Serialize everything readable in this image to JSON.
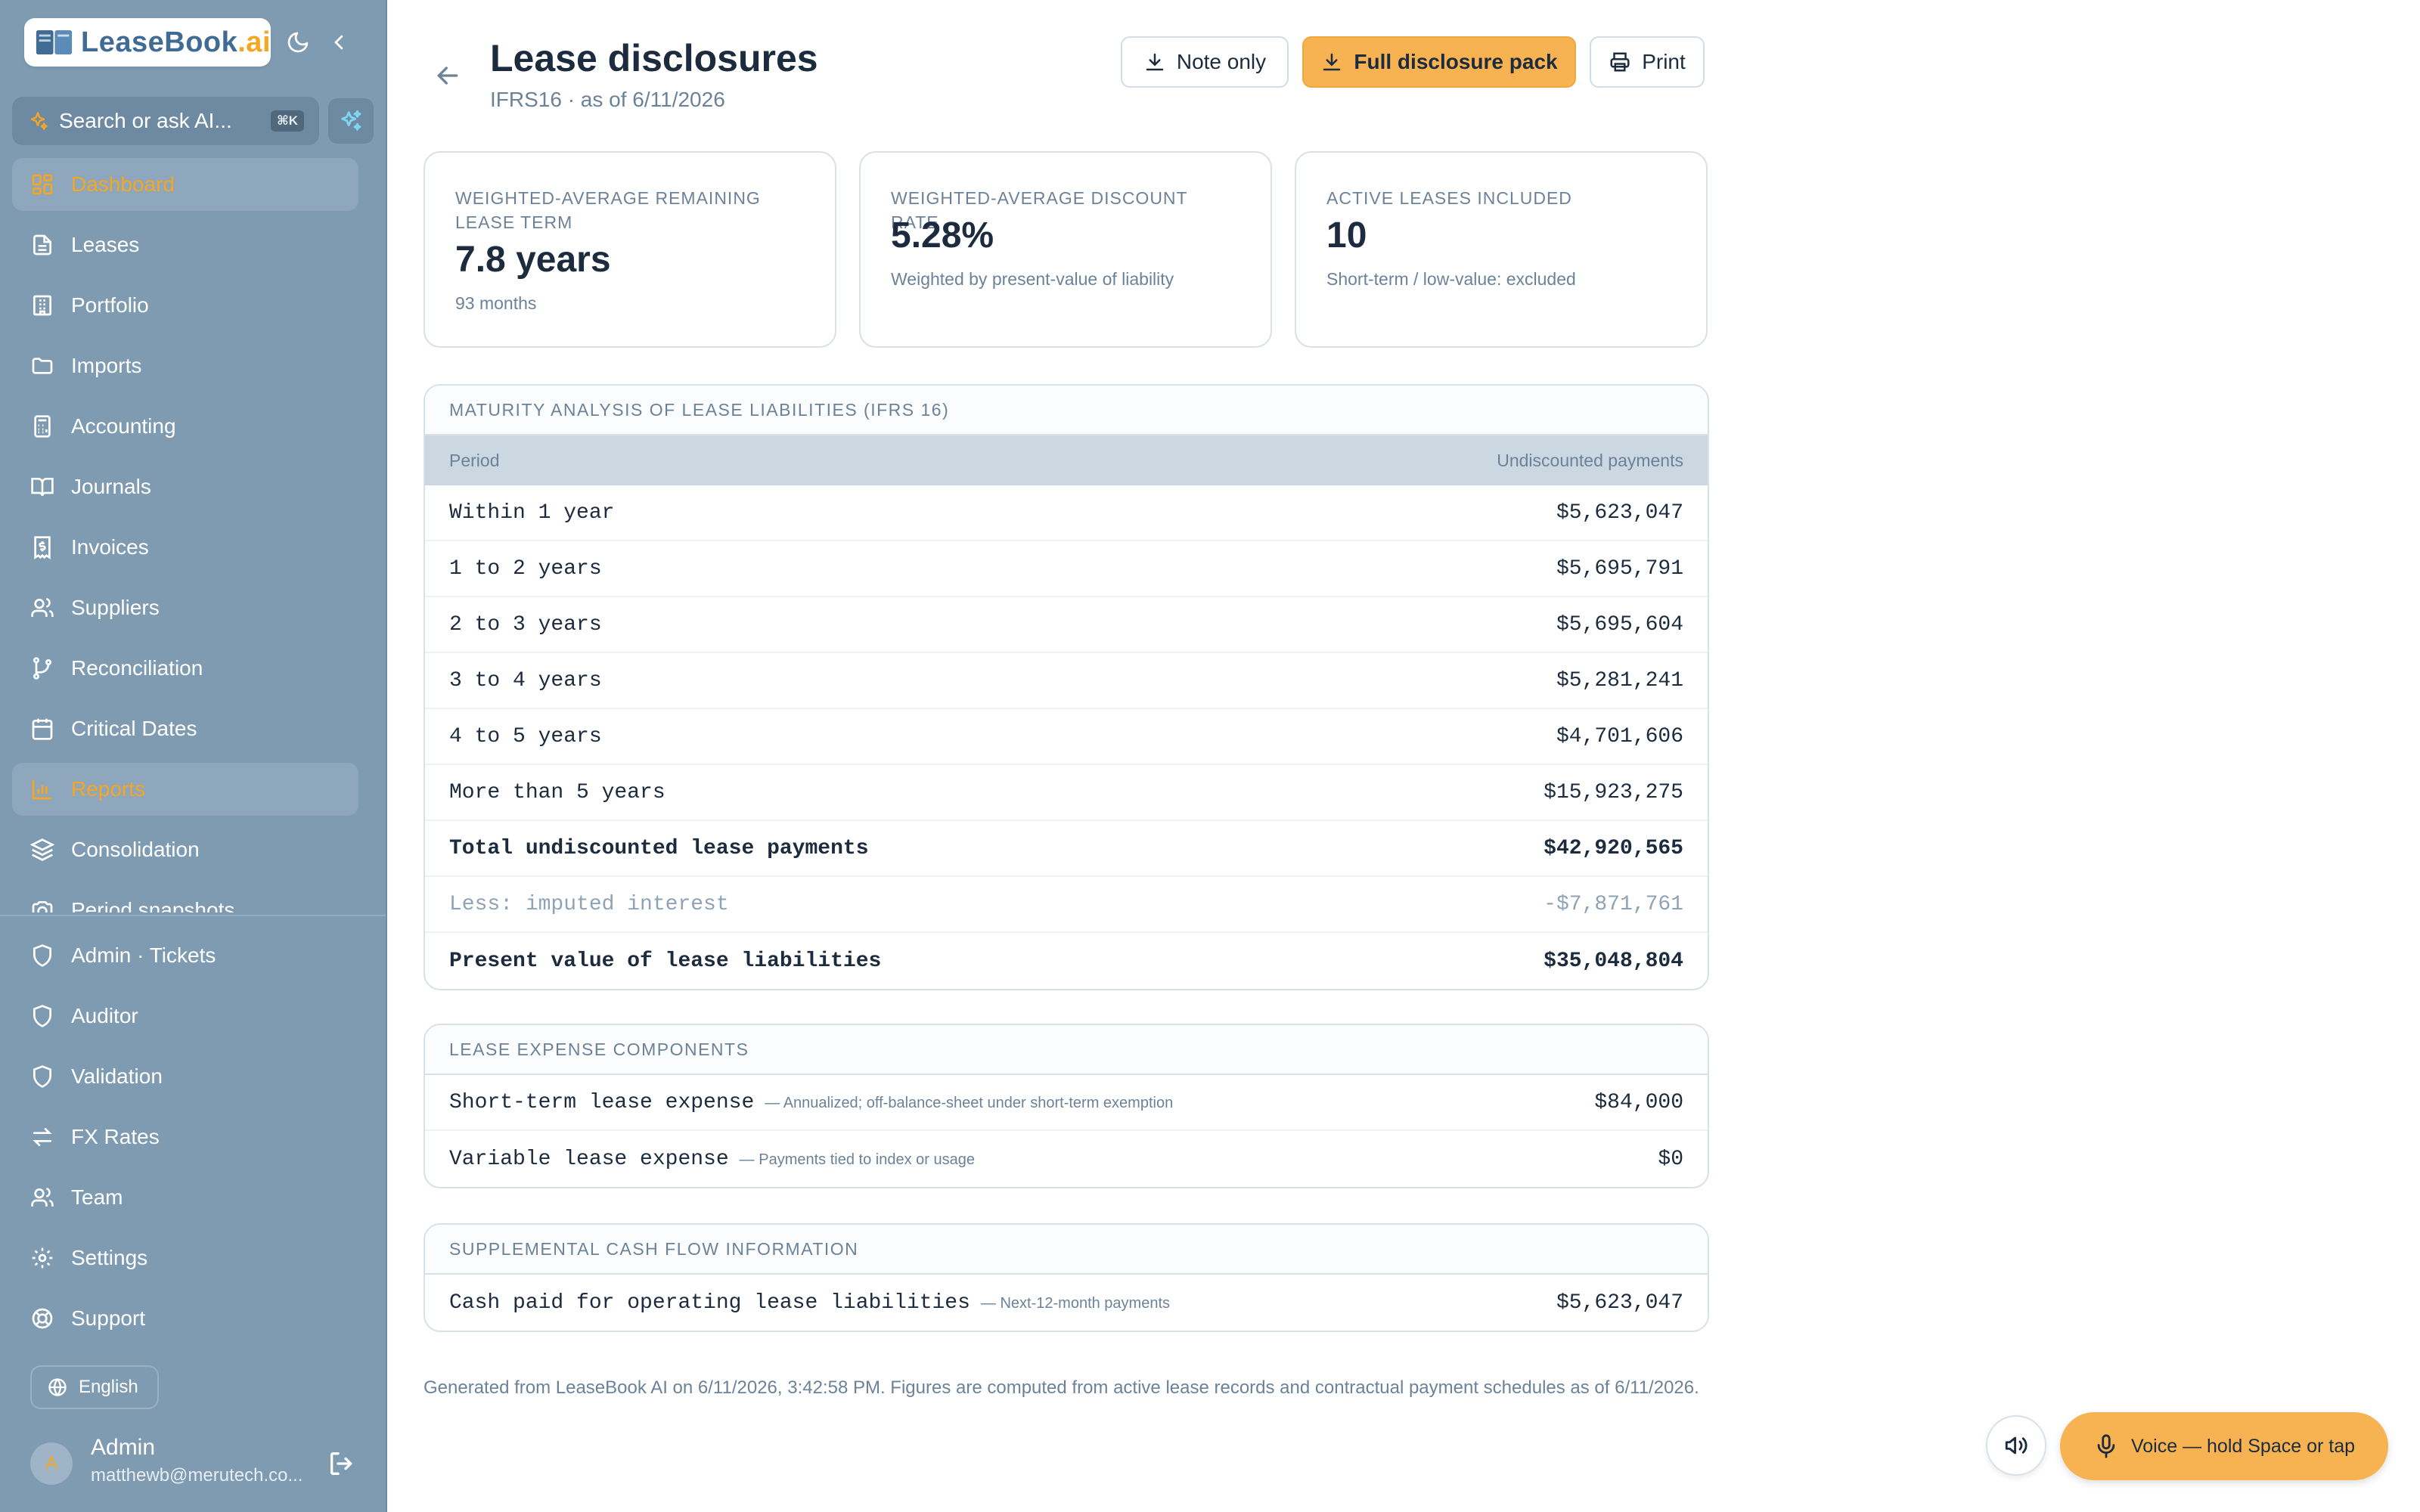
{
  "app": {
    "brand_main": "LeaseBook",
    "brand_suffix": ".ai"
  },
  "sidebar": {
    "search_placeholder": "Search or ask AI...",
    "search_shortcut": "⌘K",
    "items": [
      {
        "label": "Dashboard",
        "icon": "dashboard-icon",
        "active": true
      },
      {
        "label": "Leases",
        "icon": "file-icon"
      },
      {
        "label": "Portfolio",
        "icon": "building-icon"
      },
      {
        "label": "Imports",
        "icon": "folder-icon"
      },
      {
        "label": "Accounting",
        "icon": "calculator-icon"
      },
      {
        "label": "Journals",
        "icon": "book-icon"
      },
      {
        "label": "Invoices",
        "icon": "receipt-icon"
      },
      {
        "label": "Suppliers",
        "icon": "users-icon"
      },
      {
        "label": "Reconciliation",
        "icon": "git-branch-icon"
      },
      {
        "label": "Critical Dates",
        "icon": "calendar-icon"
      },
      {
        "label": "Reports",
        "icon": "bar-chart-icon",
        "active": true
      },
      {
        "label": "Consolidation",
        "icon": "layers-icon"
      },
      {
        "label": "Period snapshots",
        "icon": "camera-icon"
      }
    ],
    "bottom_items": [
      {
        "label": "Admin · Tickets",
        "icon": "shield-icon"
      },
      {
        "label": "Auditor",
        "icon": "shield-icon"
      },
      {
        "label": "Validation",
        "icon": "shield-icon"
      },
      {
        "label": "FX Rates",
        "icon": "swap-icon"
      },
      {
        "label": "Team",
        "icon": "users-icon"
      },
      {
        "label": "Settings",
        "icon": "gear-icon"
      },
      {
        "label": "Support",
        "icon": "lifebuoy-icon"
      }
    ],
    "language": "English",
    "user": {
      "initial": "A",
      "name": "Admin",
      "email": "matthewb@merutech.co..."
    }
  },
  "header": {
    "title": "Lease disclosures",
    "subtitle": "IFRS16 · as of 6/11/2026",
    "buttons": {
      "note_only": "Note only",
      "full_pack": "Full disclosure pack",
      "print": "Print"
    }
  },
  "stats": [
    {
      "label": "Weighted-average remaining lease term",
      "value": "7.8 years",
      "note": "93 months"
    },
    {
      "label": "Weighted-average discount rate",
      "value": "5.28%",
      "note": "Weighted by present-value of liability"
    },
    {
      "label": "Active leases included",
      "value": "10",
      "note": "Short-term / low-value: excluded"
    }
  ],
  "maturity": {
    "heading": "Maturity analysis of lease liabilities (IFRS 16)",
    "col_period": "Period",
    "col_payments": "Undiscounted payments",
    "rows": [
      {
        "period": "Within 1 year",
        "amount": "$5,623,047",
        "style": ""
      },
      {
        "period": "1 to 2 years",
        "amount": "$5,695,791",
        "style": ""
      },
      {
        "period": "2 to 3 years",
        "amount": "$5,695,604",
        "style": ""
      },
      {
        "period": "3 to 4 years",
        "amount": "$5,281,241",
        "style": ""
      },
      {
        "period": "4 to 5 years",
        "amount": "$4,701,606",
        "style": ""
      },
      {
        "period": "More than 5 years",
        "amount": "$15,923,275",
        "style": ""
      },
      {
        "period": "Total undiscounted lease payments",
        "amount": "$42,920,565",
        "style": "bold"
      },
      {
        "period": "Less: imputed interest",
        "amount": "-$7,871,761",
        "style": "muted"
      },
      {
        "period": "Present value of lease liabilities",
        "amount": "$35,048,804",
        "style": "bold"
      }
    ]
  },
  "expense": {
    "heading": "Lease expense components",
    "rows": [
      {
        "label": "Short-term lease expense",
        "note": "— Annualized; off-balance-sheet under short-term exemption",
        "amount": "$84,000"
      },
      {
        "label": "Variable lease expense",
        "note": "— Payments tied to index or usage",
        "amount": "$0"
      }
    ]
  },
  "cashflow": {
    "heading": "Supplemental cash flow information",
    "rows": [
      {
        "label": "Cash paid for operating lease liabilities",
        "note": "— Next-12-month payments",
        "amount": "$5,623,047"
      }
    ]
  },
  "footer": "Generated from LeaseBook AI on 6/11/2026, 3:42:58 PM. Figures are computed from active lease records and contractual payment schedules as of 6/11/2026.",
  "voice": {
    "label": "Voice — hold Space or tap"
  },
  "colors": {
    "accent": "#f5a623",
    "sidebar_bg": "#7f9bb2",
    "primary_button": "#f7b351"
  }
}
